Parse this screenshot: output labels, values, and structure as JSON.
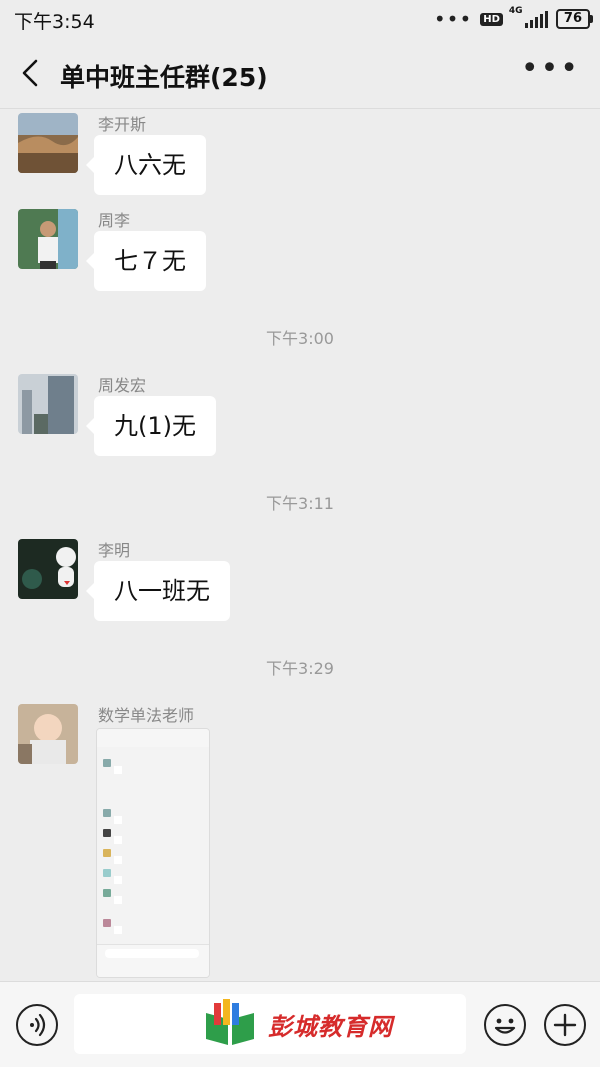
{
  "status_bar": {
    "time": "下午3:54",
    "dots": "•••",
    "hd_badge": "HD",
    "network": "4G",
    "battery": "76"
  },
  "header": {
    "title": "单中班主任群(25)",
    "more_label": "•••"
  },
  "messages": [
    {
      "sender": "李开斯",
      "text": "八六无"
    },
    {
      "sender": "周李",
      "text": "七７无"
    },
    {
      "sender": "周发宏",
      "text": "九(1)无"
    },
    {
      "sender": "李明",
      "text": "八一班无"
    },
    {
      "sender": "数学单法老师",
      "type": "image"
    }
  ],
  "timestamps": [
    "下午3:00",
    "下午3:11",
    "下午3:29"
  ],
  "bottom_bar": {
    "watermark_text": "彭城教育网"
  },
  "colors": {
    "background": "#ededed",
    "bubble": "#ffffff",
    "watermark_red": "#d62b2b"
  }
}
